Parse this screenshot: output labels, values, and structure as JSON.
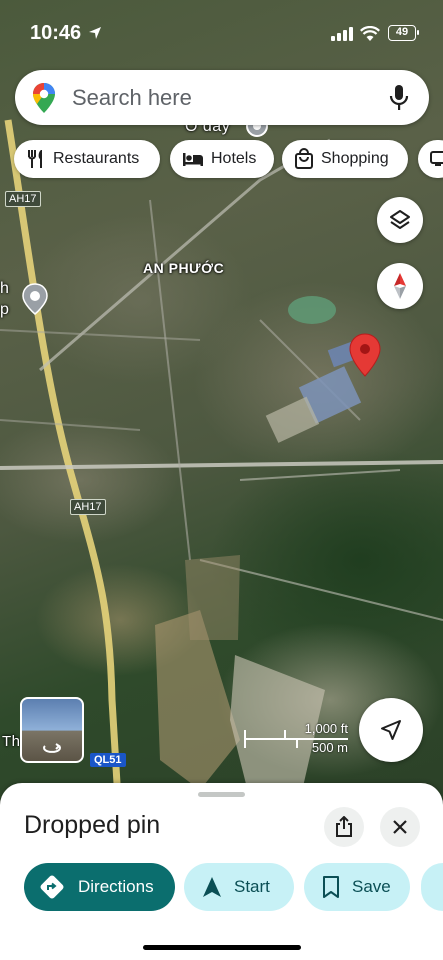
{
  "status_bar": {
    "time": "10:46",
    "battery": "49"
  },
  "search": {
    "placeholder": "Search here"
  },
  "chips": [
    {
      "label": "Restaurants",
      "icon": "fork-knife-icon"
    },
    {
      "label": "Hotels",
      "icon": "bed-icon"
    },
    {
      "label": "Shopping",
      "icon": "shopping-bag-icon"
    }
  ],
  "map": {
    "place_labels": [
      "AN PHƯỚC",
      "Ô đây",
      "h",
      "p",
      "Th"
    ],
    "road_shields": [
      "AH17",
      "AH17"
    ],
    "route_shield": "QL51",
    "scale": {
      "feet": "1,000 ft",
      "meters": "500 m"
    },
    "pin_color": "#e53935"
  },
  "sheet": {
    "title": "Dropped pin",
    "actions": [
      {
        "label": "Directions",
        "icon": "directions-icon"
      },
      {
        "label": "Start",
        "icon": "navigation-arrow-icon"
      },
      {
        "label": "Save",
        "icon": "bookmark-icon"
      }
    ]
  },
  "colors": {
    "primary_button": "#0b6e6e",
    "secondary_button": "#c7f1f6"
  }
}
